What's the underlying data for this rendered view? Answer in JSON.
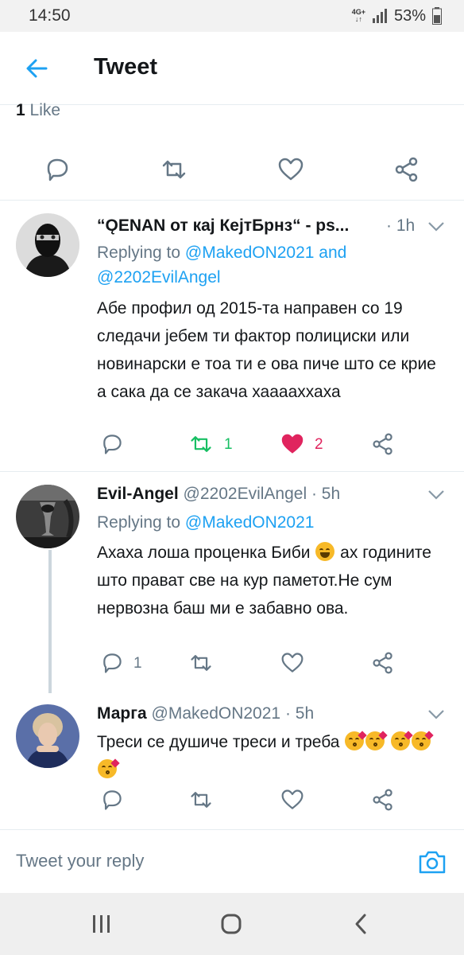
{
  "status_bar": {
    "time": "14:50",
    "network": "4G+",
    "battery": "53%"
  },
  "header": {
    "title": "Tweet"
  },
  "main_tweet": {
    "like_count": "1",
    "like_label": "Like"
  },
  "replies": [
    {
      "name": "“ǪENAN от кај КејтБрнз“ - ps...",
      "time": "· 1h",
      "replying_prefix": "Replying to ",
      "replying_handles": "@MakedON2021 and @2202EvilAngel",
      "text": "Абе профил од 2015-та направен со 19 следачи јебем ти фактор полициски или новинарски е тоа ти е ова пиче што се крие а сака да се закача хааааххаха",
      "retweets": "1",
      "likes": "2"
    },
    {
      "name": "Evil-Angel",
      "handle": "@2202EvilAngel",
      "time": "· 5h",
      "replying_prefix": "Replying to ",
      "replying_handles": "@MakedON2021",
      "text_a": "Ахаха лоша проценка Биби",
      "text_b": " ах годините што прават све на кур паметот.Не сум нервозна баш ми е забавно ова.",
      "replies": "1"
    },
    {
      "name": "Марга",
      "handle": "@MakedON2021",
      "time": "· 5h",
      "text": "Треси се душиче треси и треба"
    }
  ],
  "reply_bar": {
    "placeholder": "Tweet your reply"
  },
  "icons": [
    "back-arrow-icon",
    "reply-icon",
    "retweet-icon",
    "like-icon",
    "share-icon",
    "chevron-down-icon",
    "camera-icon",
    "recent-apps-icon",
    "home-icon",
    "back-nav-icon"
  ],
  "colors": {
    "accent": "#1da1f2",
    "retweet": "#17bf63",
    "like": "#e0245e",
    "muted": "#657786"
  }
}
